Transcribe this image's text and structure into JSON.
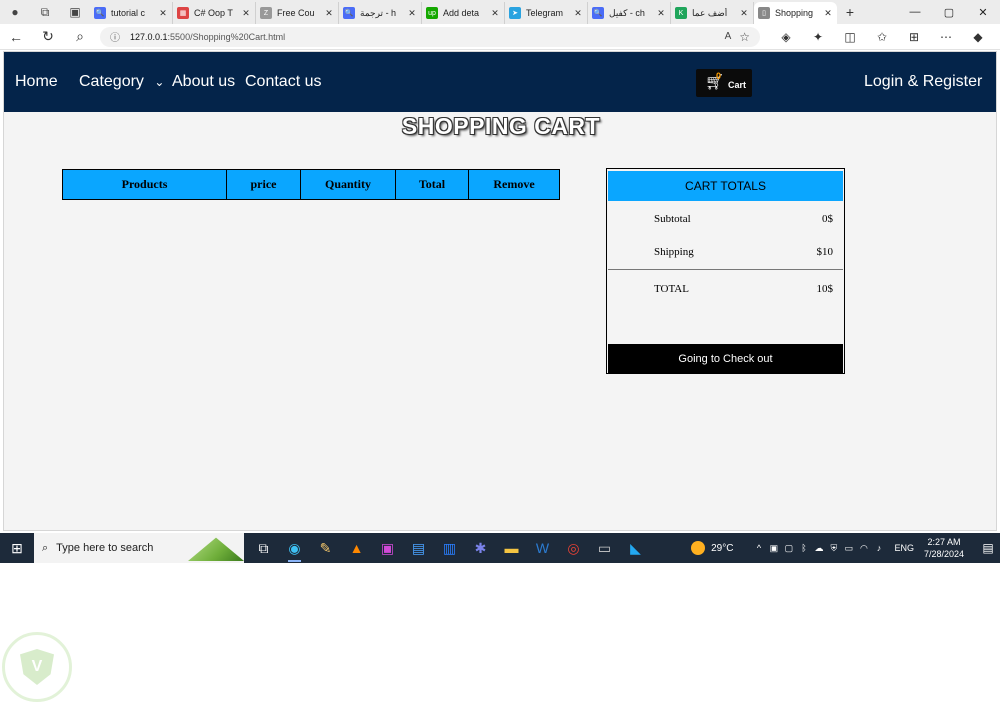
{
  "browser": {
    "tabs": [
      {
        "title": "tutorial c",
        "fav_color": "#4a6cf7",
        "fav_glyph": "🔍"
      },
      {
        "title": "C# Oop T",
        "fav_color": "#d44",
        "fav_glyph": "▦"
      },
      {
        "title": "Free Cou",
        "fav_color": "#999",
        "fav_glyph": "Z"
      },
      {
        "title": "ترجمة - h",
        "fav_color": "#4a6cf7",
        "fav_glyph": "🔍"
      },
      {
        "title": "Add deta",
        "fav_color": "#14a800",
        "fav_glyph": "up"
      },
      {
        "title": "Telegram",
        "fav_color": "#2aa3e0",
        "fav_glyph": "➤"
      },
      {
        "title": "كفيل - ch",
        "fav_color": "#4a6cf7",
        "fav_glyph": "🔍"
      },
      {
        "title": "أضف عما",
        "fav_color": "#1fa55b",
        "fav_glyph": "K"
      },
      {
        "title": "Shopping",
        "fav_color": "#888",
        "fav_glyph": "▯"
      }
    ],
    "new_tab": "+",
    "window_controls": [
      "—",
      "▢",
      "✕"
    ],
    "url_host": "127.0.0.1",
    "url_path": ":5500/Shopping%20Cart.html",
    "toolbar_icons": [
      "read-aloud-icon",
      "favorites-star-icon"
    ]
  },
  "nav": {
    "home": "Home",
    "category": "Category",
    "category_arrow": "⌄",
    "about": "About us",
    "contact": "Contact us",
    "cart_count": "0",
    "cart_label": "Cart",
    "login": "Login & Register"
  },
  "page_title": "SHOPPING CART",
  "table": {
    "headers": [
      "Products",
      "price",
      "Quantity",
      "Total",
      "Remove"
    ]
  },
  "totals": {
    "heading": "CART TOTALS",
    "subtotal_label": "Subtotal",
    "subtotal_value": "0$",
    "shipping_label": "Shipping",
    "shipping_value": "$10",
    "total_label": "TOTAL",
    "total_value": "10$",
    "checkout": "Going to Check out"
  },
  "colors": {
    "navbar": "#04244a",
    "accent_blue": "#0aa6ff",
    "checkout_bg": "#000000"
  },
  "taskbar": {
    "search_placeholder": "Type here to search",
    "weather": "29°C",
    "lang": "ENG",
    "time": "2:27 AM",
    "date": "7/28/2024"
  }
}
